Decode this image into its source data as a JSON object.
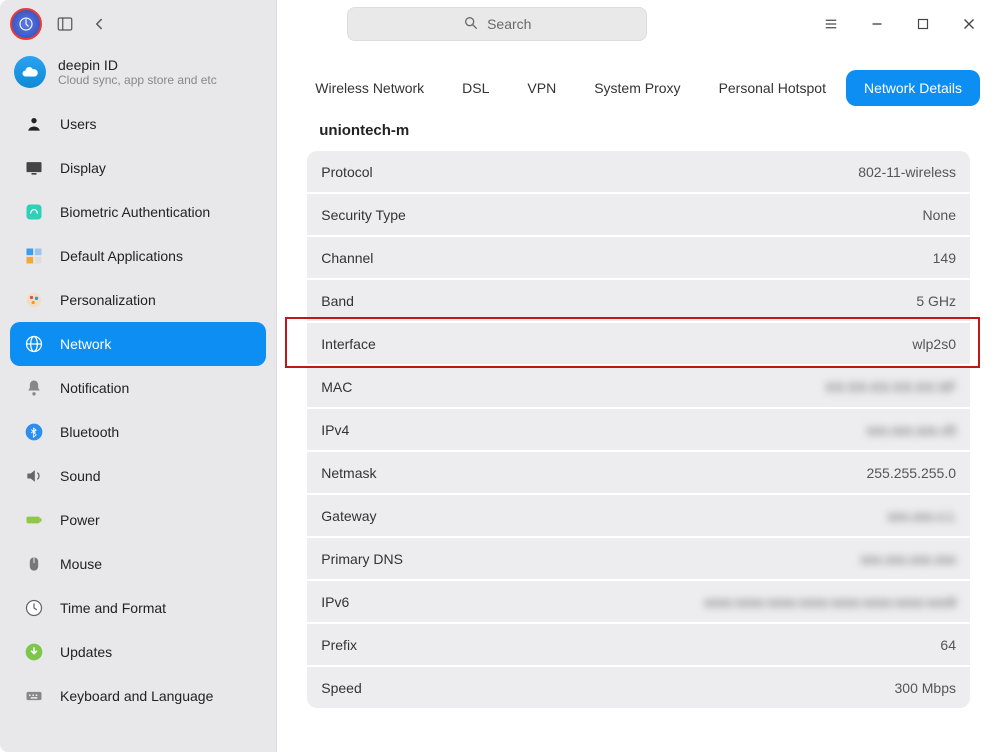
{
  "search": {
    "placeholder": "Search"
  },
  "account": {
    "title": "deepin ID",
    "sub": "Cloud sync, app store and etc"
  },
  "sidebar": {
    "items": [
      {
        "label": "Users"
      },
      {
        "label": "Display"
      },
      {
        "label": "Biometric Authentication"
      },
      {
        "label": "Default Applications"
      },
      {
        "label": "Personalization"
      },
      {
        "label": "Network"
      },
      {
        "label": "Notification"
      },
      {
        "label": "Bluetooth"
      },
      {
        "label": "Sound"
      },
      {
        "label": "Power"
      },
      {
        "label": "Mouse"
      },
      {
        "label": "Time and Format"
      },
      {
        "label": "Updates"
      },
      {
        "label": "Keyboard and Language"
      }
    ]
  },
  "tabs": [
    {
      "label": "Wireless Network"
    },
    {
      "label": "DSL"
    },
    {
      "label": "VPN"
    },
    {
      "label": "System Proxy"
    },
    {
      "label": "Personal Hotspot"
    },
    {
      "label": "Network Details"
    }
  ],
  "section_title": "uniontech-m",
  "details": [
    {
      "label": "Protocol",
      "value": "802-11-wireless"
    },
    {
      "label": "Security Type",
      "value": "None"
    },
    {
      "label": "Channel",
      "value": "149"
    },
    {
      "label": "Band",
      "value": "5 GHz"
    },
    {
      "label": "Interface",
      "value": "wlp2s0"
    },
    {
      "label": "MAC",
      "value": "XX:XX:XX:XX:XX:XF"
    },
    {
      "label": "IPv4",
      "value": "xxx.xxx.xxx.x5"
    },
    {
      "label": "Netmask",
      "value": "255.255.255.0"
    },
    {
      "label": "Gateway",
      "value": "xxx.xxx.x.L"
    },
    {
      "label": "Primary DNS",
      "value": "xxx.xxx.xxx.xxx"
    },
    {
      "label": "IPv6",
      "value": "xxxx:xxxx:xxxx:xxxx:xxxx:xxxx:xxxx:xxx9"
    },
    {
      "label": "Prefix",
      "value": "64"
    },
    {
      "label": "Speed",
      "value": "300 Mbps"
    }
  ],
  "highlighted_row_index": 4
}
